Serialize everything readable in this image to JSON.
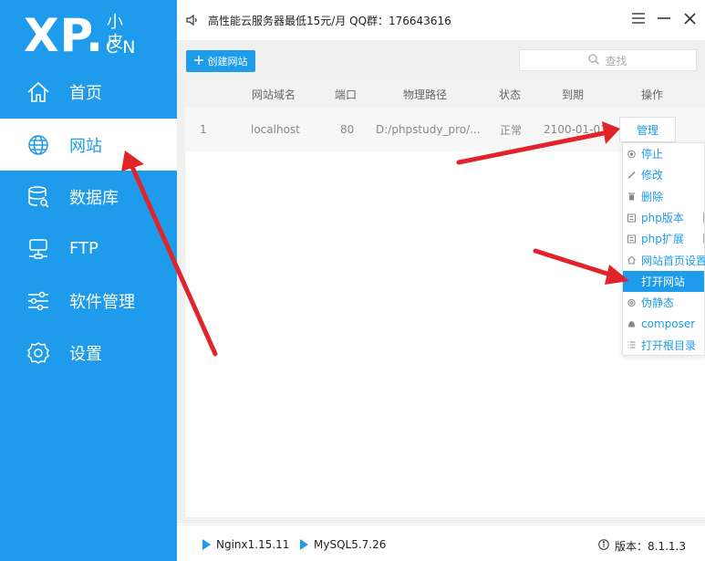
{
  "logo": {
    "main": "XP.",
    "cn_top": "小皮",
    "cn_bottom": "CN"
  },
  "nav": [
    {
      "label": "首页",
      "icon": "home-icon"
    },
    {
      "label": "网站",
      "icon": "globe-icon",
      "active": true
    },
    {
      "label": "数据库",
      "icon": "database-icon"
    },
    {
      "label": "FTP",
      "icon": "ftp-server-icon"
    },
    {
      "label": "软件管理",
      "icon": "sliders-icon"
    },
    {
      "label": "设置",
      "icon": "gear-icon"
    }
  ],
  "topbar": {
    "ad_text": "高性能云服务器最低15元/月  QQ群：176643616"
  },
  "toolbar": {
    "create_label": "创建网站",
    "search_placeholder": "查找"
  },
  "table": {
    "headers": [
      "网站域名",
      "端口",
      "物理路径",
      "状态",
      "到期",
      "操作"
    ],
    "rows": [
      {
        "index": "1",
        "domain": "localhost",
        "port": "80",
        "path": "D:/phpstudy_pro/...",
        "status": "正常",
        "expire": "2100-01-01",
        "action": "管理"
      }
    ]
  },
  "menu": {
    "items": [
      {
        "label": "停止",
        "icon": "stop-icon"
      },
      {
        "label": "修改",
        "icon": "pencil-icon"
      },
      {
        "label": "删除",
        "icon": "trash-icon"
      },
      {
        "label": "php版本",
        "icon": "version-icon",
        "has_sub": true
      },
      {
        "label": "php扩展",
        "icon": "extension-icon",
        "has_sub": true
      },
      {
        "label": "网站首页设置",
        "icon": "homepage-icon"
      },
      {
        "label": "打开网站",
        "icon": "open-site-icon",
        "highlighted": true
      },
      {
        "label": "伪静态",
        "icon": "rewrite-icon"
      },
      {
        "label": "composer",
        "icon": "composer-icon"
      },
      {
        "label": "打开根目录",
        "icon": "folder-list-icon"
      }
    ]
  },
  "footer": {
    "nginx": "Nginx1.15.11",
    "mysql": "MySQL5.7.26",
    "version": "版本：8.1.1.3"
  },
  "colors": {
    "accent": "#1e9bea",
    "annotation_arrow": "#e0242a"
  }
}
